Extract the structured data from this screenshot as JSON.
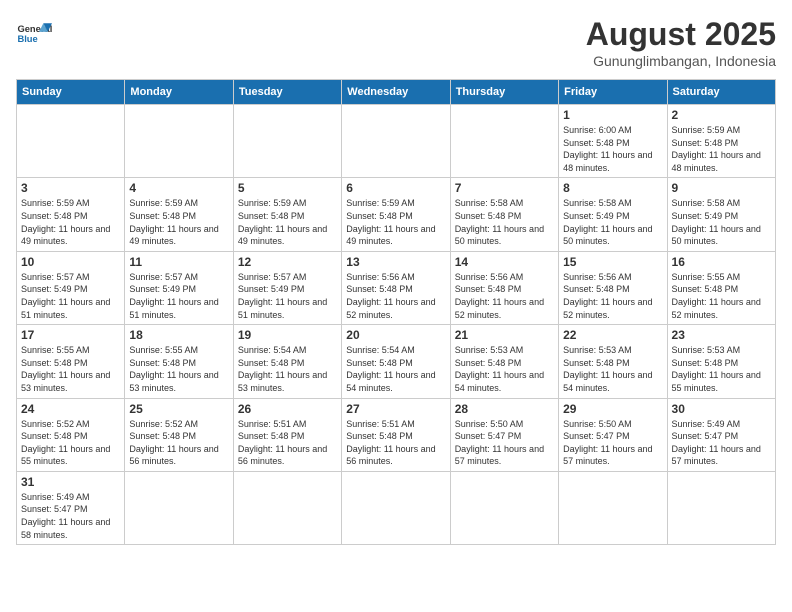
{
  "header": {
    "logo_general": "General",
    "logo_blue": "Blue",
    "title": "August 2025",
    "subtitle": "Gununglimbangan, Indonesia"
  },
  "days_of_week": [
    "Sunday",
    "Monday",
    "Tuesday",
    "Wednesday",
    "Thursday",
    "Friday",
    "Saturday"
  ],
  "weeks": [
    [
      {
        "day": "",
        "info": ""
      },
      {
        "day": "",
        "info": ""
      },
      {
        "day": "",
        "info": ""
      },
      {
        "day": "",
        "info": ""
      },
      {
        "day": "",
        "info": ""
      },
      {
        "day": "1",
        "info": "Sunrise: 6:00 AM\nSunset: 5:48 PM\nDaylight: 11 hours and 48 minutes."
      },
      {
        "day": "2",
        "info": "Sunrise: 5:59 AM\nSunset: 5:48 PM\nDaylight: 11 hours and 48 minutes."
      }
    ],
    [
      {
        "day": "3",
        "info": "Sunrise: 5:59 AM\nSunset: 5:48 PM\nDaylight: 11 hours and 49 minutes."
      },
      {
        "day": "4",
        "info": "Sunrise: 5:59 AM\nSunset: 5:48 PM\nDaylight: 11 hours and 49 minutes."
      },
      {
        "day": "5",
        "info": "Sunrise: 5:59 AM\nSunset: 5:48 PM\nDaylight: 11 hours and 49 minutes."
      },
      {
        "day": "6",
        "info": "Sunrise: 5:59 AM\nSunset: 5:48 PM\nDaylight: 11 hours and 49 minutes."
      },
      {
        "day": "7",
        "info": "Sunrise: 5:58 AM\nSunset: 5:48 PM\nDaylight: 11 hours and 50 minutes."
      },
      {
        "day": "8",
        "info": "Sunrise: 5:58 AM\nSunset: 5:49 PM\nDaylight: 11 hours and 50 minutes."
      },
      {
        "day": "9",
        "info": "Sunrise: 5:58 AM\nSunset: 5:49 PM\nDaylight: 11 hours and 50 minutes."
      }
    ],
    [
      {
        "day": "10",
        "info": "Sunrise: 5:57 AM\nSunset: 5:49 PM\nDaylight: 11 hours and 51 minutes."
      },
      {
        "day": "11",
        "info": "Sunrise: 5:57 AM\nSunset: 5:49 PM\nDaylight: 11 hours and 51 minutes."
      },
      {
        "day": "12",
        "info": "Sunrise: 5:57 AM\nSunset: 5:49 PM\nDaylight: 11 hours and 51 minutes."
      },
      {
        "day": "13",
        "info": "Sunrise: 5:56 AM\nSunset: 5:48 PM\nDaylight: 11 hours and 52 minutes."
      },
      {
        "day": "14",
        "info": "Sunrise: 5:56 AM\nSunset: 5:48 PM\nDaylight: 11 hours and 52 minutes."
      },
      {
        "day": "15",
        "info": "Sunrise: 5:56 AM\nSunset: 5:48 PM\nDaylight: 11 hours and 52 minutes."
      },
      {
        "day": "16",
        "info": "Sunrise: 5:55 AM\nSunset: 5:48 PM\nDaylight: 11 hours and 52 minutes."
      }
    ],
    [
      {
        "day": "17",
        "info": "Sunrise: 5:55 AM\nSunset: 5:48 PM\nDaylight: 11 hours and 53 minutes."
      },
      {
        "day": "18",
        "info": "Sunrise: 5:55 AM\nSunset: 5:48 PM\nDaylight: 11 hours and 53 minutes."
      },
      {
        "day": "19",
        "info": "Sunrise: 5:54 AM\nSunset: 5:48 PM\nDaylight: 11 hours and 53 minutes."
      },
      {
        "day": "20",
        "info": "Sunrise: 5:54 AM\nSunset: 5:48 PM\nDaylight: 11 hours and 54 minutes."
      },
      {
        "day": "21",
        "info": "Sunrise: 5:53 AM\nSunset: 5:48 PM\nDaylight: 11 hours and 54 minutes."
      },
      {
        "day": "22",
        "info": "Sunrise: 5:53 AM\nSunset: 5:48 PM\nDaylight: 11 hours and 54 minutes."
      },
      {
        "day": "23",
        "info": "Sunrise: 5:53 AM\nSunset: 5:48 PM\nDaylight: 11 hours and 55 minutes."
      }
    ],
    [
      {
        "day": "24",
        "info": "Sunrise: 5:52 AM\nSunset: 5:48 PM\nDaylight: 11 hours and 55 minutes."
      },
      {
        "day": "25",
        "info": "Sunrise: 5:52 AM\nSunset: 5:48 PM\nDaylight: 11 hours and 56 minutes."
      },
      {
        "day": "26",
        "info": "Sunrise: 5:51 AM\nSunset: 5:48 PM\nDaylight: 11 hours and 56 minutes."
      },
      {
        "day": "27",
        "info": "Sunrise: 5:51 AM\nSunset: 5:48 PM\nDaylight: 11 hours and 56 minutes."
      },
      {
        "day": "28",
        "info": "Sunrise: 5:50 AM\nSunset: 5:47 PM\nDaylight: 11 hours and 57 minutes."
      },
      {
        "day": "29",
        "info": "Sunrise: 5:50 AM\nSunset: 5:47 PM\nDaylight: 11 hours and 57 minutes."
      },
      {
        "day": "30",
        "info": "Sunrise: 5:49 AM\nSunset: 5:47 PM\nDaylight: 11 hours and 57 minutes."
      }
    ],
    [
      {
        "day": "31",
        "info": "Sunrise: 5:49 AM\nSunset: 5:47 PM\nDaylight: 11 hours and 58 minutes."
      },
      {
        "day": "",
        "info": ""
      },
      {
        "day": "",
        "info": ""
      },
      {
        "day": "",
        "info": ""
      },
      {
        "day": "",
        "info": ""
      },
      {
        "day": "",
        "info": ""
      },
      {
        "day": "",
        "info": ""
      }
    ]
  ],
  "colors": {
    "header_bg": "#1a6faf",
    "header_text": "#ffffff",
    "border": "#cccccc",
    "day_num": "#333333",
    "day_info": "#333333"
  }
}
